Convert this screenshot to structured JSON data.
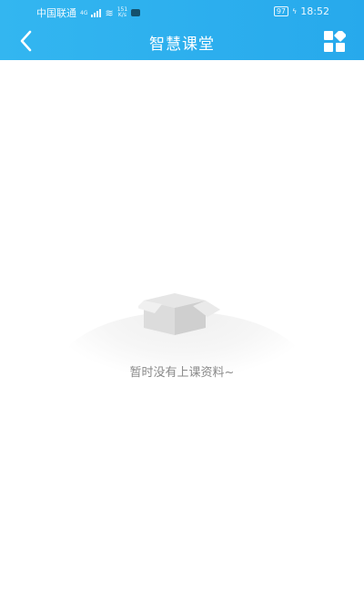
{
  "status_bar": {
    "carrier": "中国联通",
    "network": "4G",
    "net_speed_value": "151",
    "net_speed_unit": "K/s",
    "battery": "97",
    "time": "18:52"
  },
  "header": {
    "title": "智慧课堂",
    "back_icon": "chevron-left-icon",
    "menu_icon": "grid-icon"
  },
  "empty_state": {
    "icon": "empty-box-icon",
    "message": "暂时没有上课资料~"
  },
  "colors": {
    "header_bg": "#2eaef0",
    "empty_text": "#8a8a8a",
    "page_bg": "#ffffff"
  }
}
